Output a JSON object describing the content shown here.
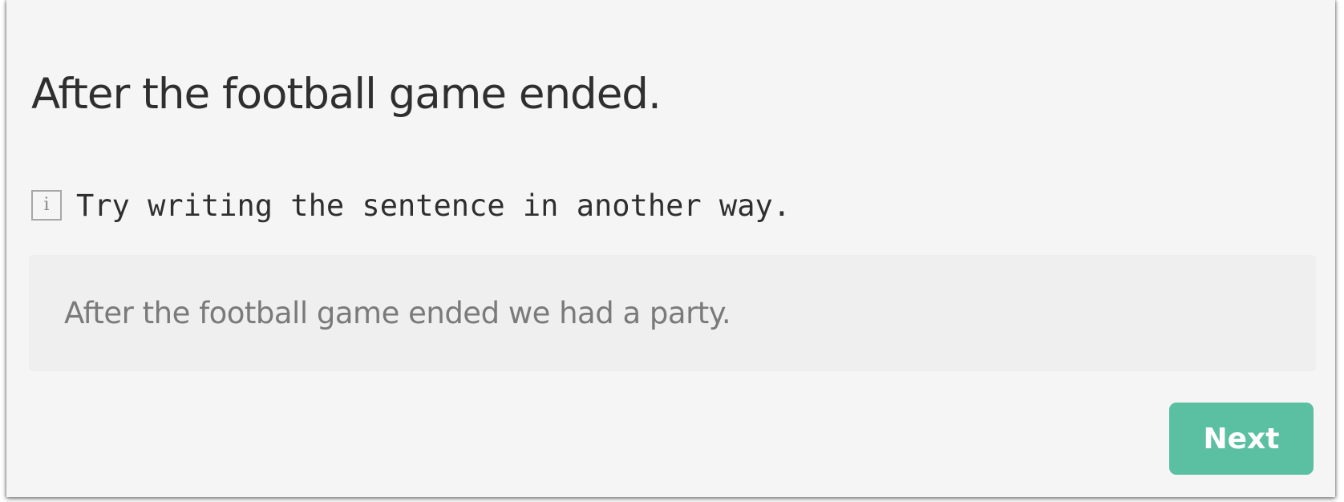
{
  "prompt": {
    "title": "After the football game ended."
  },
  "hint": {
    "icon": "info-icon",
    "icon_glyph": "i",
    "text": "Try writing the sentence in another way."
  },
  "answer": {
    "value": "After the football game ended we had a party."
  },
  "actions": {
    "next_label": "Next"
  },
  "colors": {
    "card_background": "#f5f5f5",
    "answer_background": "#efefef",
    "button_accent": "#5bbfa2",
    "text_primary": "#2f2f2f",
    "text_secondary": "#7a7a7a"
  }
}
